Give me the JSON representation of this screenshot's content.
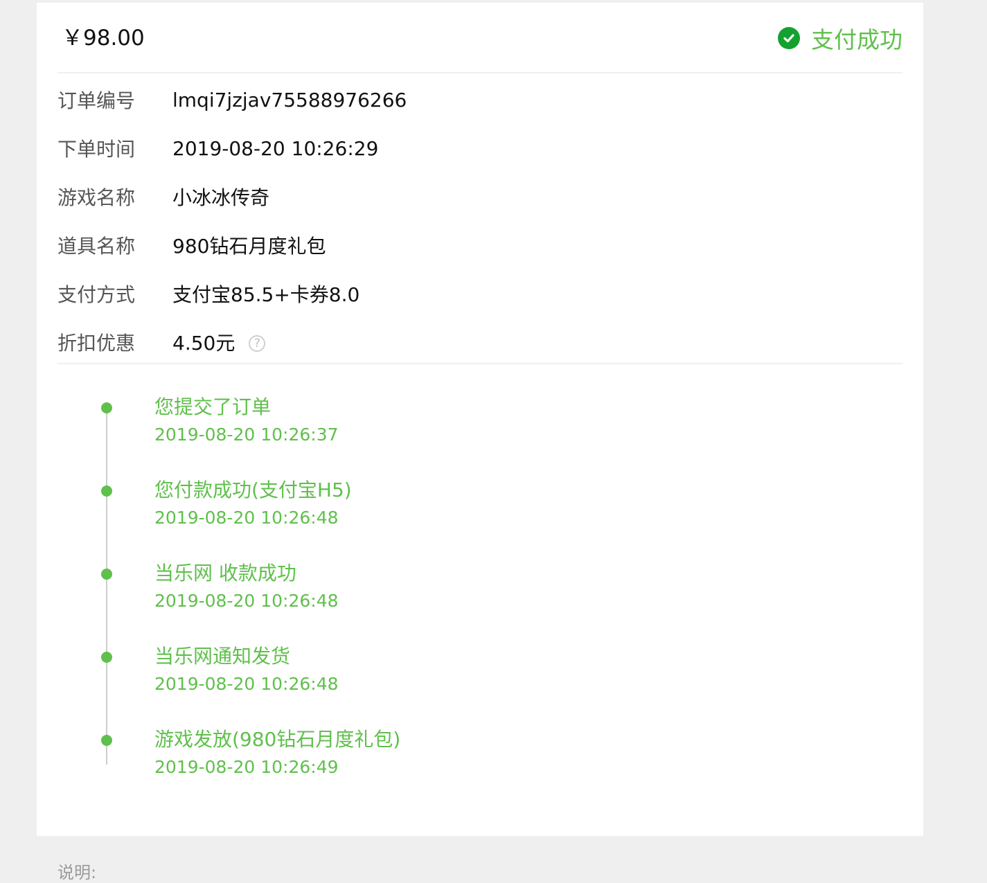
{
  "order": {
    "amount": "￥98.00",
    "status": "支付成功",
    "status_icon": "check-circle-icon",
    "accent_color": "#5fc04b",
    "icon_color": "#13a12f"
  },
  "details": [
    {
      "label": "订单编号",
      "value": "lmqi7jzjav75588976266"
    },
    {
      "label": "下单时间",
      "value": "2019-08-20 10:26:29"
    },
    {
      "label": "游戏名称",
      "value": "小冰冰传奇"
    },
    {
      "label": "道具名称",
      "value": "980钻石月度礼包"
    },
    {
      "label": "支付方式",
      "value": "支付宝85.5+卡券8.0"
    },
    {
      "label": "折扣优惠",
      "value": "4.50元",
      "help_icon": "question-icon",
      "help_glyph": "?"
    }
  ],
  "timeline": [
    {
      "title": "您提交了订单",
      "time": "2019-08-20 10:26:37"
    },
    {
      "title": "您付款成功(支付宝H5)",
      "time": "2019-08-20 10:26:48"
    },
    {
      "title": "当乐网 收款成功",
      "time": "2019-08-20 10:26:48"
    },
    {
      "title": "当乐网通知发货",
      "time": "2019-08-20 10:26:48"
    },
    {
      "title": "游戏发放(980钻石月度礼包)",
      "time": "2019-08-20 10:26:49"
    }
  ],
  "footer": {
    "note_label": "说明:"
  }
}
